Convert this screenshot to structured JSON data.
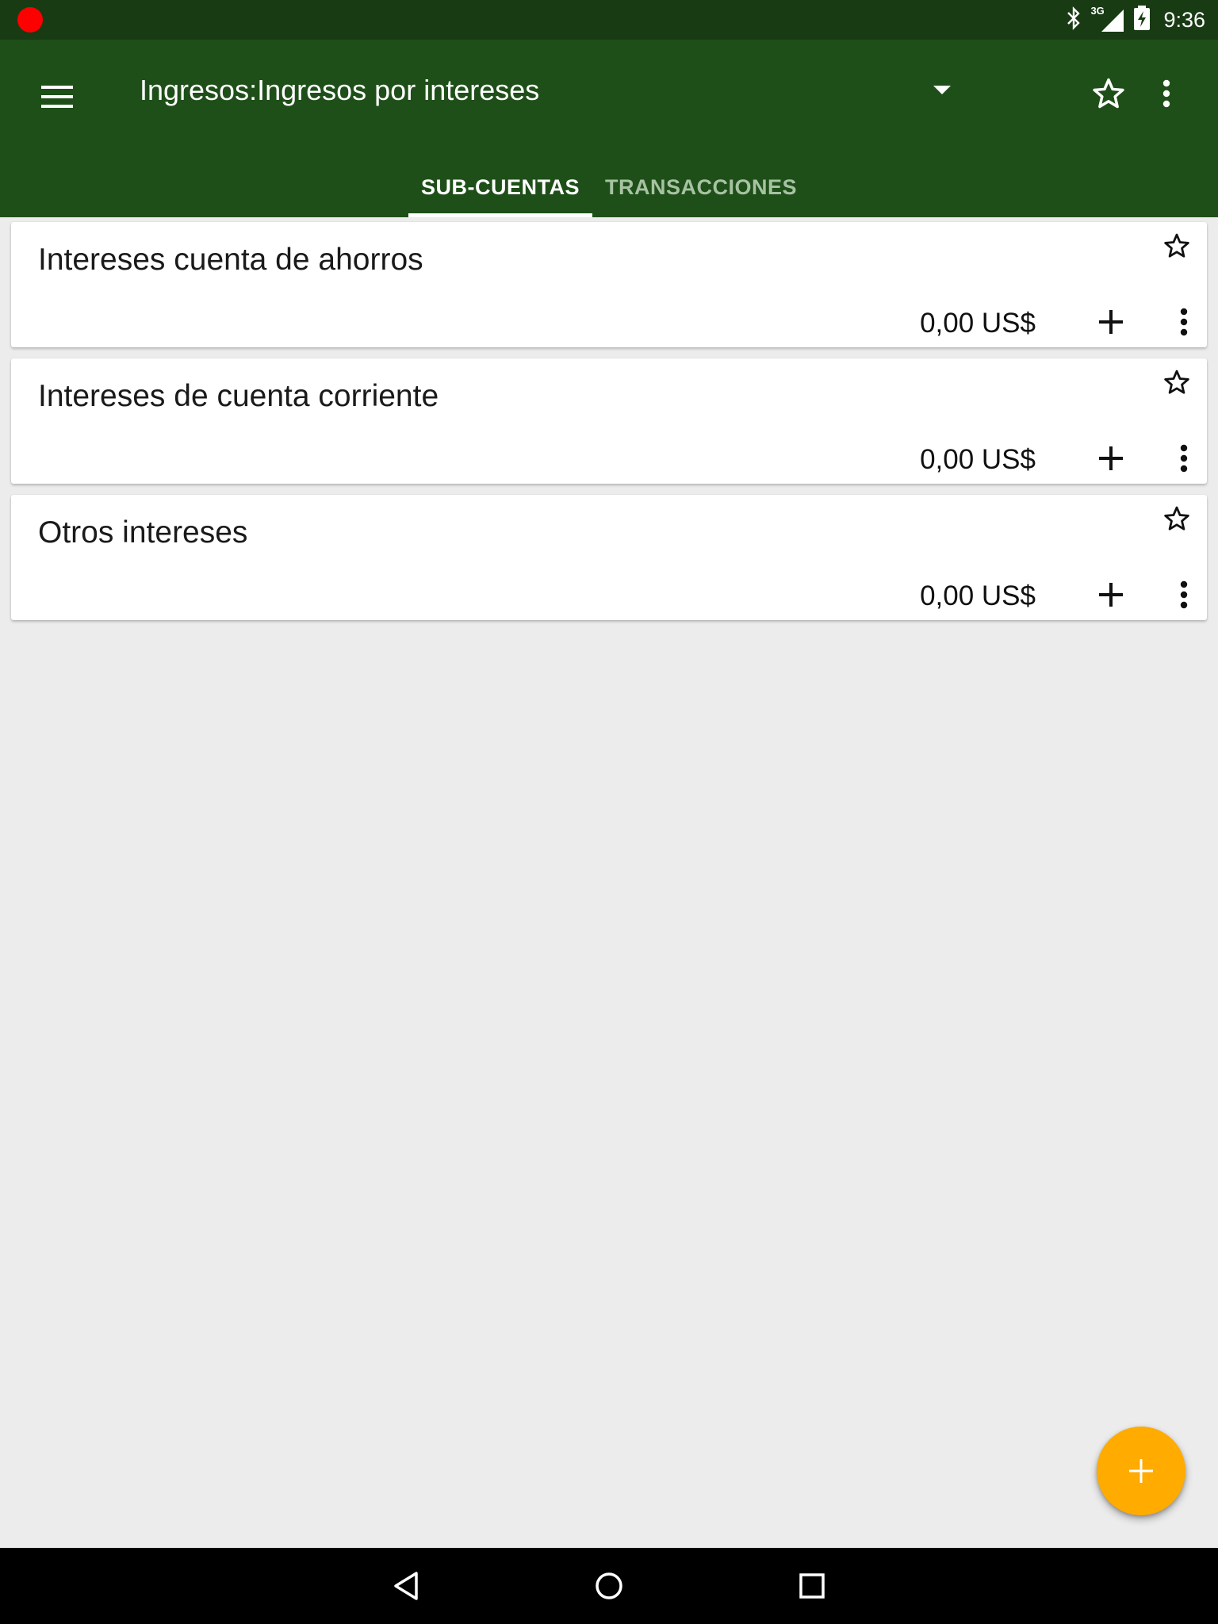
{
  "status_bar": {
    "time": "9:36",
    "network_type": "3G",
    "icons": [
      "recording-indicator",
      "bluetooth-icon",
      "cell-signal-icon",
      "battery-charging-icon"
    ]
  },
  "app_bar": {
    "title": "Ingresos:Ingresos por intereses",
    "icons": [
      "menu-icon",
      "dropdown-arrow-icon",
      "star-outline-icon",
      "more-vert-icon"
    ],
    "tabs": [
      {
        "label": "SUB-CUENTAS",
        "selected": true
      },
      {
        "label": "TRANSACCIONES",
        "selected": false
      }
    ]
  },
  "accounts": [
    {
      "name": "Intereses cuenta de ahorros",
      "balance": "0,00 US$",
      "favorite": false
    },
    {
      "name": "Intereses de cuenta corriente",
      "balance": "0,00 US$",
      "favorite": false
    },
    {
      "name": "Otros intereses",
      "balance": "0,00 US$",
      "favorite": false
    }
  ],
  "fab": {
    "icon": "plus-icon"
  },
  "nav_bar": {
    "icons": [
      "back-icon",
      "home-icon",
      "recents-icon"
    ]
  },
  "colors": {
    "status_bar": "#183b14",
    "app_bar": "#1e4f18",
    "background": "#ececec",
    "fab": "#ffab00",
    "tab_inactive": "#a7c2a3"
  }
}
